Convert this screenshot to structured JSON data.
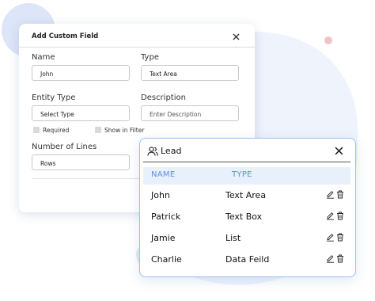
{
  "colors": {
    "accent": "#5b8fe0",
    "header_bg": "#e8f0fb",
    "lead_border": "#9fc0ec",
    "blob": "#eef3fc",
    "circle_blue": "#dde5f8",
    "dot_pink": "#f2c2c6"
  },
  "custom_field": {
    "title": "Add Custom Field",
    "close_icon": "close-icon",
    "name": {
      "label": "Name",
      "value": "John"
    },
    "type": {
      "label": "Type",
      "value": "Text Area"
    },
    "entity_type": {
      "label": "Entity Type",
      "value": "Select Type"
    },
    "description": {
      "label": "Description",
      "placeholder": "Enter Description"
    },
    "required_label": "Required",
    "show_in_filter_label": "Show in Filter",
    "number_of_lines": {
      "label": "Number of Lines",
      "value": "Rows"
    }
  },
  "lead": {
    "title": "Lead",
    "icon": "users-icon",
    "close_icon": "close-icon",
    "columns": [
      "NAME",
      "TYPE"
    ],
    "rows": [
      {
        "name": "John",
        "type": "Text Area"
      },
      {
        "name": "Patrick",
        "type": "Text Box"
      },
      {
        "name": "Jamie",
        "type": "List"
      },
      {
        "name": "Charlie",
        "type": "Data Feild"
      }
    ],
    "row_actions": [
      "edit-icon",
      "trash-icon"
    ]
  }
}
